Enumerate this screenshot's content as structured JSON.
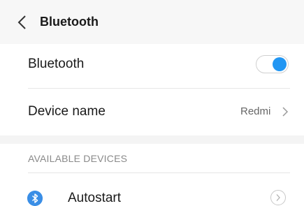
{
  "header": {
    "title": "Bluetooth",
    "back_icon": "chevron-left-icon"
  },
  "bluetooth_row": {
    "label": "Bluetooth",
    "toggle_on": true,
    "accent_color": "#2196f3"
  },
  "device_name_row": {
    "label": "Device name",
    "value": "Redmi",
    "chevron_icon": "chevron-right-icon"
  },
  "available_devices": {
    "section_title": "AVAILABLE DEVICES",
    "items": [
      {
        "label": "Autostart",
        "icon": "bluetooth-icon",
        "action_icon": "circle-chevron-right-icon"
      }
    ]
  }
}
